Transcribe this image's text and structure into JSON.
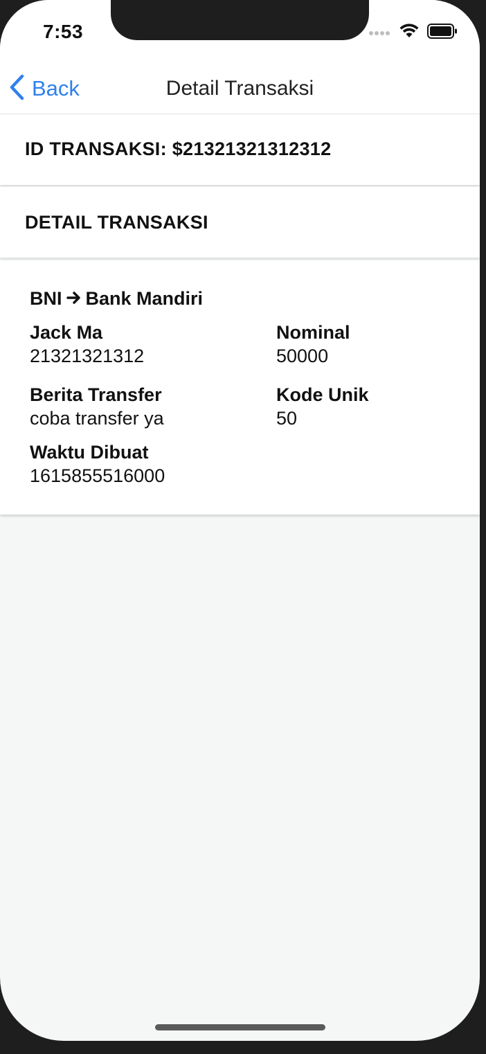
{
  "status_bar": {
    "time": "7:53"
  },
  "nav": {
    "back_label": "Back",
    "title": "Detail Transaksi"
  },
  "transaction_id": "ID TRANSAKSI: $21321321312312",
  "section_title": "DETAIL TRANSAKSI",
  "detail": {
    "route_from": "BNI",
    "route_to": "Bank Mandiri",
    "name_label": "Jack Ma",
    "name_value": "21321321312",
    "nominal_label": "Nominal",
    "nominal_value": "50000",
    "berita_label": "Berita Transfer",
    "berita_value": "coba transfer ya",
    "kode_label": "Kode Unik",
    "kode_value": "50",
    "waktu_label": "Waktu Dibuat",
    "waktu_value": "1615855516000"
  },
  "colors": {
    "accent": "#2f80ed",
    "background": "#f4f7f6",
    "frame": "#1e1e1e"
  }
}
